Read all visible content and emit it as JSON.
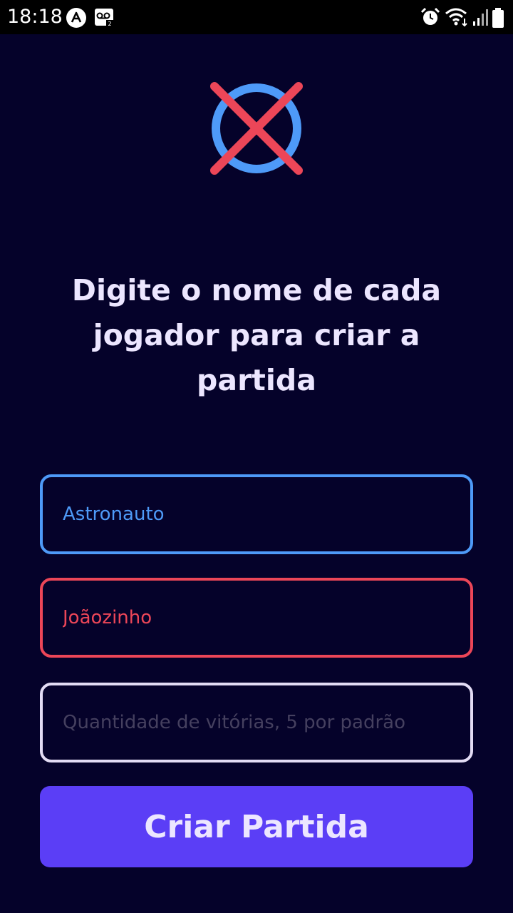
{
  "status_bar": {
    "time": "18:18",
    "left_icons": [
      "autopilot-a-icon",
      "voicemail-icon"
    ],
    "right_icons": [
      "alarm-icon",
      "wifi-icon",
      "signal-icon",
      "battery-icon"
    ]
  },
  "logo": {
    "icons": [
      "circle-o-icon",
      "cross-x-icon"
    ],
    "colors": {
      "circle": "#4e9af8",
      "cross": "#ec4658"
    }
  },
  "headline": "Digite o nome de cada jogador para criar a partida",
  "form": {
    "player1": {
      "value": "Astronauto",
      "placeholder": ""
    },
    "player2": {
      "value": "Joãozinho",
      "placeholder": ""
    },
    "wins": {
      "value": "",
      "placeholder": "Quantidade de vitórias, 5 por padrão"
    },
    "submit_label": "Criar Partida"
  },
  "colors": {
    "background": "#05022a",
    "player1": "#4e9af8",
    "player2": "#ec4658",
    "neutral_border": "#e3dcf4",
    "button": "#5b3ef6",
    "text": "#ece6ff"
  }
}
